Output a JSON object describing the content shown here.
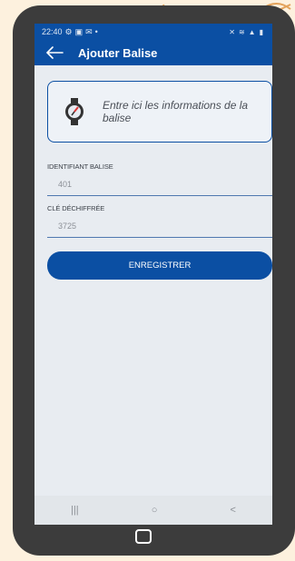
{
  "status_bar": {
    "time": "22:40",
    "left_icons": "gear-icon image-icon mail-icon dot",
    "right_icons": "mute-icon wifi-icon signal-icon battery-icon"
  },
  "app_bar": {
    "title": "Ajouter Balise",
    "back_icon": "back-arrow-icon"
  },
  "info_card": {
    "icon": "watch-icon",
    "text": "Entre ici les informations de la balise"
  },
  "fields": [
    {
      "label": "IDENTIFIANT BALISE",
      "value": "401"
    },
    {
      "label": "CLÉ DÉCHIFFRÉE",
      "value": "3725"
    }
  ],
  "save_button": {
    "label": "ENREGISTRER"
  },
  "nav_bar": {
    "recents": "|||",
    "home": "○",
    "back": "<"
  },
  "colors": {
    "primary": "#0b4fa3",
    "screen_bg": "#e8ecf1",
    "frame": "#3c3c3c",
    "page_bg": "#fdf1de"
  }
}
